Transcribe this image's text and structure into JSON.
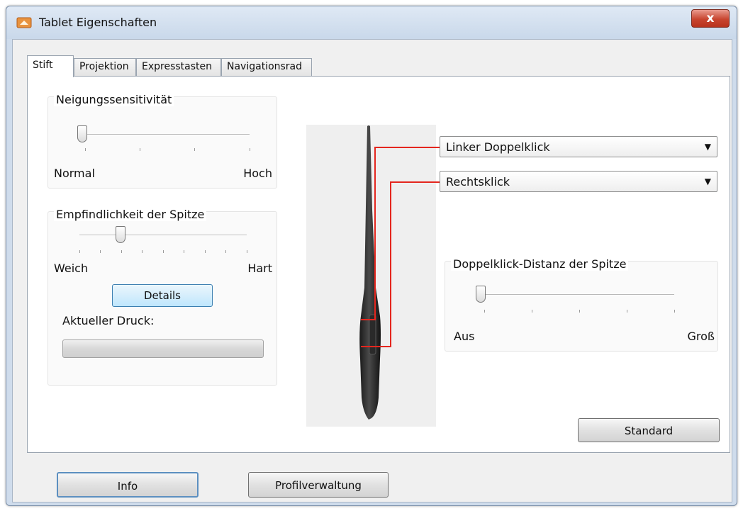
{
  "window": {
    "title": "Tablet Eigenschaften",
    "close_label": "x"
  },
  "tabs": [
    {
      "label": "Stift",
      "active": true
    },
    {
      "label": "Projektion",
      "active": false
    },
    {
      "label": "Expresstasten",
      "active": false
    },
    {
      "label": "Navigationsrad",
      "active": false
    }
  ],
  "tilt": {
    "title": "Neigungssensitivität",
    "min_label": "Normal",
    "max_label": "Hoch",
    "value_fraction": 0.0
  },
  "tip": {
    "title": "Empfindlichkeit der Spitze",
    "min_label": "Weich",
    "max_label": "Hart",
    "value_fraction": 0.27,
    "details_label": "Details",
    "pressure_label": "Aktueller Druck:",
    "pressure_fraction": 0.0
  },
  "buttons": {
    "upper": {
      "selected": "Linker Doppelklick"
    },
    "lower": {
      "selected": "Rechtsklick"
    }
  },
  "double_click": {
    "title": "Doppelklick-Distanz der Spitze",
    "min_label": "Aus",
    "max_label": "Groß",
    "value_fraction": 0.0
  },
  "footer": {
    "standard_label": "Standard",
    "info_label": "Info",
    "profile_label": "Profilverwaltung"
  },
  "colors": {
    "accent_line": "#e4261e"
  }
}
